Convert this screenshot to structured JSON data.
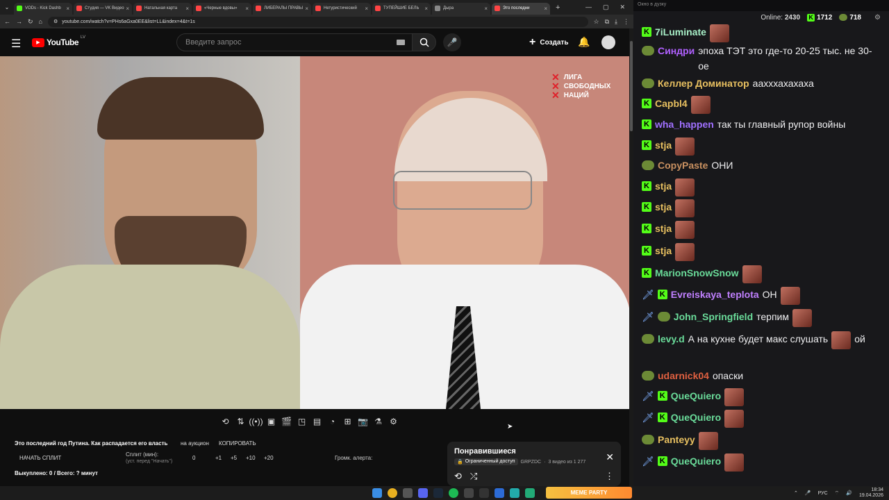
{
  "browser": {
    "tabs": [
      {
        "label": "VODs - Kick Dashb",
        "color": "#53fc18"
      },
      {
        "label": "Студия — VK Видео",
        "color": "#ff4444"
      },
      {
        "label": "Натальная карта",
        "color": "#ff4444"
      },
      {
        "label": "«Черные вдовы»",
        "color": "#ff4444"
      },
      {
        "label": "ЛИБЕРАЛЫ ПРАВЫ",
        "color": "#ff4444"
      },
      {
        "label": "Нетуристический",
        "color": "#ff4444"
      },
      {
        "label": "ТУПЕЙШИЕ БЕЛЬ",
        "color": "#ff4444"
      },
      {
        "label": "Дыра",
        "color": "#888888"
      },
      {
        "label": "Это последни",
        "color": "#ff4444",
        "active": true
      }
    ],
    "url": "youtube.com/watch?v=PHs6aGxa0EE&list=LL&index=4&t=1s"
  },
  "youtube": {
    "logo": "YouTube",
    "region": "LV",
    "search_placeholder": "Введите запрос",
    "create_label": "Создать"
  },
  "video": {
    "watermark": [
      "ЛИГА",
      "СВОБОДНЫХ",
      "НАЦИЙ"
    ]
  },
  "info": {
    "title": "Это последний год Путина. Как распадается его власть",
    "auction": "на аукцион",
    "copy": "КОПИРОВАТЬ",
    "start_split": "НАЧАТЬ СПЛИТ",
    "split_label": "Сплит (мин):",
    "split_hint": "(уст. перед \"Начать\")",
    "split_value": "0",
    "inc": [
      "+1",
      "+5",
      "+10",
      "+20"
    ],
    "alert_volume": "Громк. алерта:",
    "bought": "Выкуплено: 0 / Всего: ? минут"
  },
  "playlist": {
    "title": "Понравившиеся",
    "access": "Ограниченный доступ",
    "owner": "GRPZDC",
    "count": "3 видео из 1 277"
  },
  "chat": {
    "window_title": "Окно в дузку",
    "online_label": "Online:",
    "online": "2430",
    "stat1": "1712",
    "stat2": "718",
    "messages": [
      {
        "user": "7iLuminate",
        "color": "#a8f0c8",
        "text": "",
        "badges": [
          "K"
        ],
        "emote": true
      },
      {
        "user": "Синдри",
        "color": "#b060ff",
        "text": "эпоха ТЭТ это где-то 20-25 тыс. не 30-ое",
        "badges": [
          "P"
        ]
      },
      {
        "user": "Келлер Доминатор",
        "color": "#e8c060",
        "text": "аахххахахаха",
        "badges": [
          "P"
        ]
      },
      {
        "user": "Capbl4",
        "color": "#e8c060",
        "text": "",
        "badges": [
          "K"
        ],
        "emote": true
      },
      {
        "user": "wha_happen",
        "color": "#a070ff",
        "text": "так ты главный рупор войны",
        "badges": [
          "K"
        ]
      },
      {
        "user": "stja",
        "color": "#e8c060",
        "text": "",
        "badges": [
          "K"
        ],
        "emote": true
      },
      {
        "user": "CopyPaste",
        "color": "#c89060",
        "text": "ОНИ",
        "badges": [
          "P"
        ]
      },
      {
        "user": "stja",
        "color": "#e8c060",
        "text": "",
        "badges": [
          "K"
        ],
        "emote": true
      },
      {
        "user": "stja",
        "color": "#e8c060",
        "text": "",
        "badges": [
          "K"
        ],
        "emote": true
      },
      {
        "user": "stja",
        "color": "#e8c060",
        "text": "",
        "badges": [
          "K"
        ],
        "emote": true
      },
      {
        "user": "stja",
        "color": "#e8c060",
        "text": "",
        "badges": [
          "K"
        ],
        "emote": true
      },
      {
        "user": "MarionSnowSnow",
        "color": "#6adc9a",
        "text": "",
        "badges": [
          "K"
        ],
        "emote": true
      },
      {
        "user": "Evreiskaya_teplota",
        "color": "#c080ff",
        "text": "ОН",
        "badges": [
          "S",
          "K"
        ],
        "emote": true
      },
      {
        "user": "John_Springfield",
        "color": "#6adc9a",
        "text": "терпим",
        "badges": [
          "S",
          "P"
        ],
        "emote": true
      },
      {
        "user": "levy.d",
        "color": "#6adc9a",
        "text": "А на кухне будет макс слушать",
        "badges": [
          "P"
        ],
        "emote": true,
        "tail": "ой"
      },
      {
        "user": "udarnick04",
        "color": "#e06040",
        "text": "опаски",
        "badges": [
          "P"
        ]
      },
      {
        "user": "QueQuiero",
        "color": "#6adc9a",
        "text": "",
        "badges": [
          "S",
          "K"
        ],
        "emote": true
      },
      {
        "user": "QueQuiero",
        "color": "#6adc9a",
        "text": "",
        "badges": [
          "S",
          "K"
        ],
        "emote": true
      },
      {
        "user": "Panteyy",
        "color": "#e8c060",
        "text": "",
        "badges": [
          "P"
        ],
        "emote": true
      },
      {
        "user": "QueQuiero",
        "color": "#6adc9a",
        "text": "",
        "badges": [
          "S",
          "K"
        ],
        "emote": true
      }
    ]
  },
  "taskbar": {
    "lang": "РУС",
    "time": "18:34",
    "date": "19.04.2026",
    "banner": "MEME PARTY"
  }
}
